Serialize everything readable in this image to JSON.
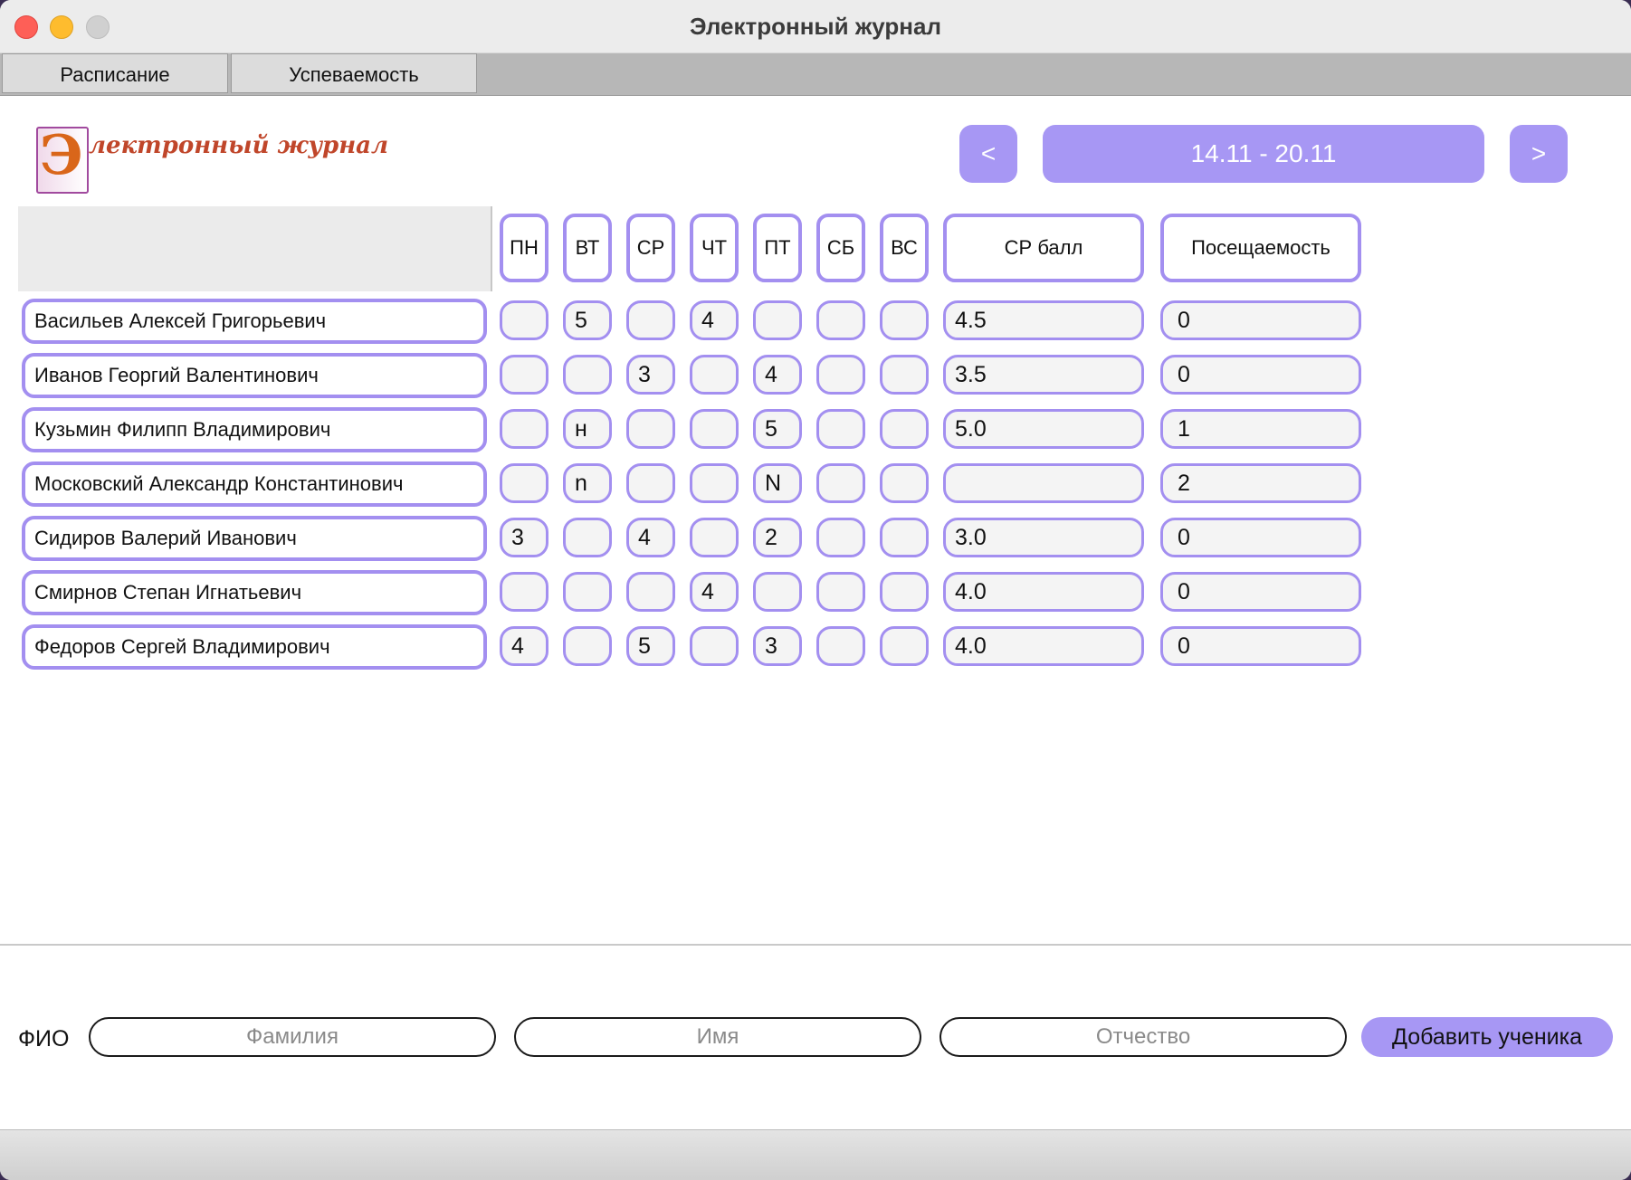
{
  "window": {
    "title": "Электронный журнал"
  },
  "tabs": [
    {
      "label": "Расписание"
    },
    {
      "label": "Успеваемость"
    }
  ],
  "logo": {
    "letter": "Э",
    "text": "лектронный журнал"
  },
  "week_nav": {
    "prev_label": "<",
    "range": "14.11 - 20.11",
    "next_label": ">"
  },
  "table": {
    "day_headers": [
      "ПН",
      "ВТ",
      "СР",
      "ЧТ",
      "ПТ",
      "СБ",
      "ВС"
    ],
    "avg_header": "СР балл",
    "attendance_header": "Посещаемость",
    "rows": [
      {
        "name": "Васильев Алексей Григорьевич",
        "grades": [
          "",
          "5",
          "",
          "4",
          "",
          "",
          ""
        ],
        "avg": "4.5",
        "attendance": "0"
      },
      {
        "name": "Иванов Георгий Валентинович",
        "grades": [
          "",
          "",
          "3",
          "",
          "4",
          "",
          ""
        ],
        "avg": "3.5",
        "attendance": "0"
      },
      {
        "name": "Кузьмин Филипп Владимирович",
        "grades": [
          "",
          "н",
          "",
          "",
          "5",
          "",
          ""
        ],
        "avg": "5.0",
        "attendance": "1"
      },
      {
        "name": "Московский Александр Константинович",
        "grades": [
          "",
          "n",
          "",
          "",
          "N",
          "",
          ""
        ],
        "avg": "",
        "attendance": "2"
      },
      {
        "name": "Сидиров Валерий Иванович",
        "grades": [
          "3",
          "",
          "4",
          "",
          "2",
          "",
          ""
        ],
        "avg": "3.0",
        "attendance": "0"
      },
      {
        "name": "Смирнов Степан Игнатьевич",
        "grades": [
          "",
          "",
          "",
          "4",
          "",
          "",
          ""
        ],
        "avg": "4.0",
        "attendance": "0"
      },
      {
        "name": "Федоров Сергей Владимирович",
        "grades": [
          "4",
          "",
          "5",
          "",
          "3",
          "",
          ""
        ],
        "avg": "4.0",
        "attendance": "0"
      }
    ]
  },
  "add_student": {
    "label": "ФИО",
    "surname_placeholder": "Фамилия",
    "name_placeholder": "Имя",
    "patronymic_placeholder": "Отчество",
    "button_label": "Добавить ученика"
  },
  "colors": {
    "accent": "#a797f4",
    "cell_border": "#a38ff0"
  }
}
